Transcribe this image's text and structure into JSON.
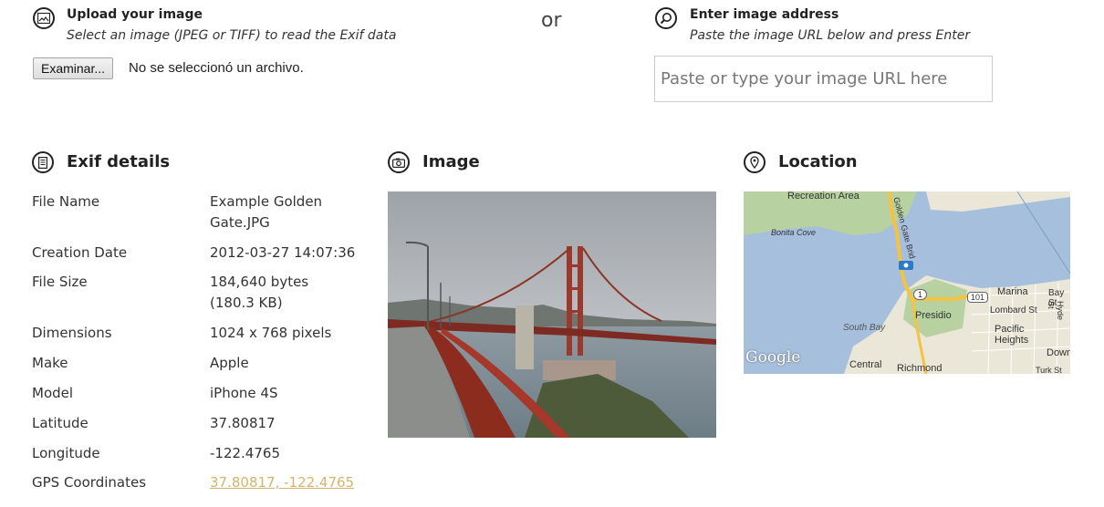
{
  "upload": {
    "title": "Upload your image",
    "subtitle": "Select an image (JPEG or TIFF) to read the Exif data",
    "button_label": "Examinar...",
    "file_status": "No se seleccionó un archivo."
  },
  "or_label": "or",
  "url_entry": {
    "title": "Enter image address",
    "subtitle": "Paste the image URL below and press Enter",
    "placeholder": "Paste or type your image URL here"
  },
  "exif": {
    "title": "Exif details",
    "rows": [
      {
        "label": "File Name",
        "value": "Example Golden Gate.JPG"
      },
      {
        "label": "Creation Date",
        "value": "2012-03-27 14:07:36"
      },
      {
        "label": "File Size",
        "value": "184,640 bytes (180.3 KB)"
      },
      {
        "label": "Dimensions",
        "value": "1024 x 768 pixels"
      },
      {
        "label": "Make",
        "value": "Apple"
      },
      {
        "label": "Model",
        "value": "iPhone 4S"
      },
      {
        "label": "Latitude",
        "value": "37.80817"
      },
      {
        "label": "Longitude",
        "value": "-122.4765"
      },
      {
        "label": "GPS Coordinates",
        "value": "37.80817, -122.4765"
      }
    ]
  },
  "image_section": {
    "title": "Image"
  },
  "location_section": {
    "title": "Location",
    "map_labels": {
      "recreation_area": "Recreation Area",
      "bonita_cove": "Bonita Cove",
      "golden_gate_bridge": "Golden Gate Brid",
      "south_bay": "South Bay",
      "presidio": "Presidio",
      "marina": "Marina",
      "lombard": "Lombard St",
      "pacific_heights": "Pacific Heights",
      "central": "Central",
      "richmond": "Richmond",
      "downtown": "Downto",
      "bay_st": "Bay St",
      "hyde_st": "Hyde St",
      "turk_st": "Turk St",
      "route_1": "1",
      "route_101": "101",
      "google": "Google"
    }
  },
  "colors": {
    "link": "#d4b46a",
    "water": "#a5bfdd",
    "land": "#eae6d8",
    "park": "#b7d1a1",
    "highway": "#f5c242"
  }
}
